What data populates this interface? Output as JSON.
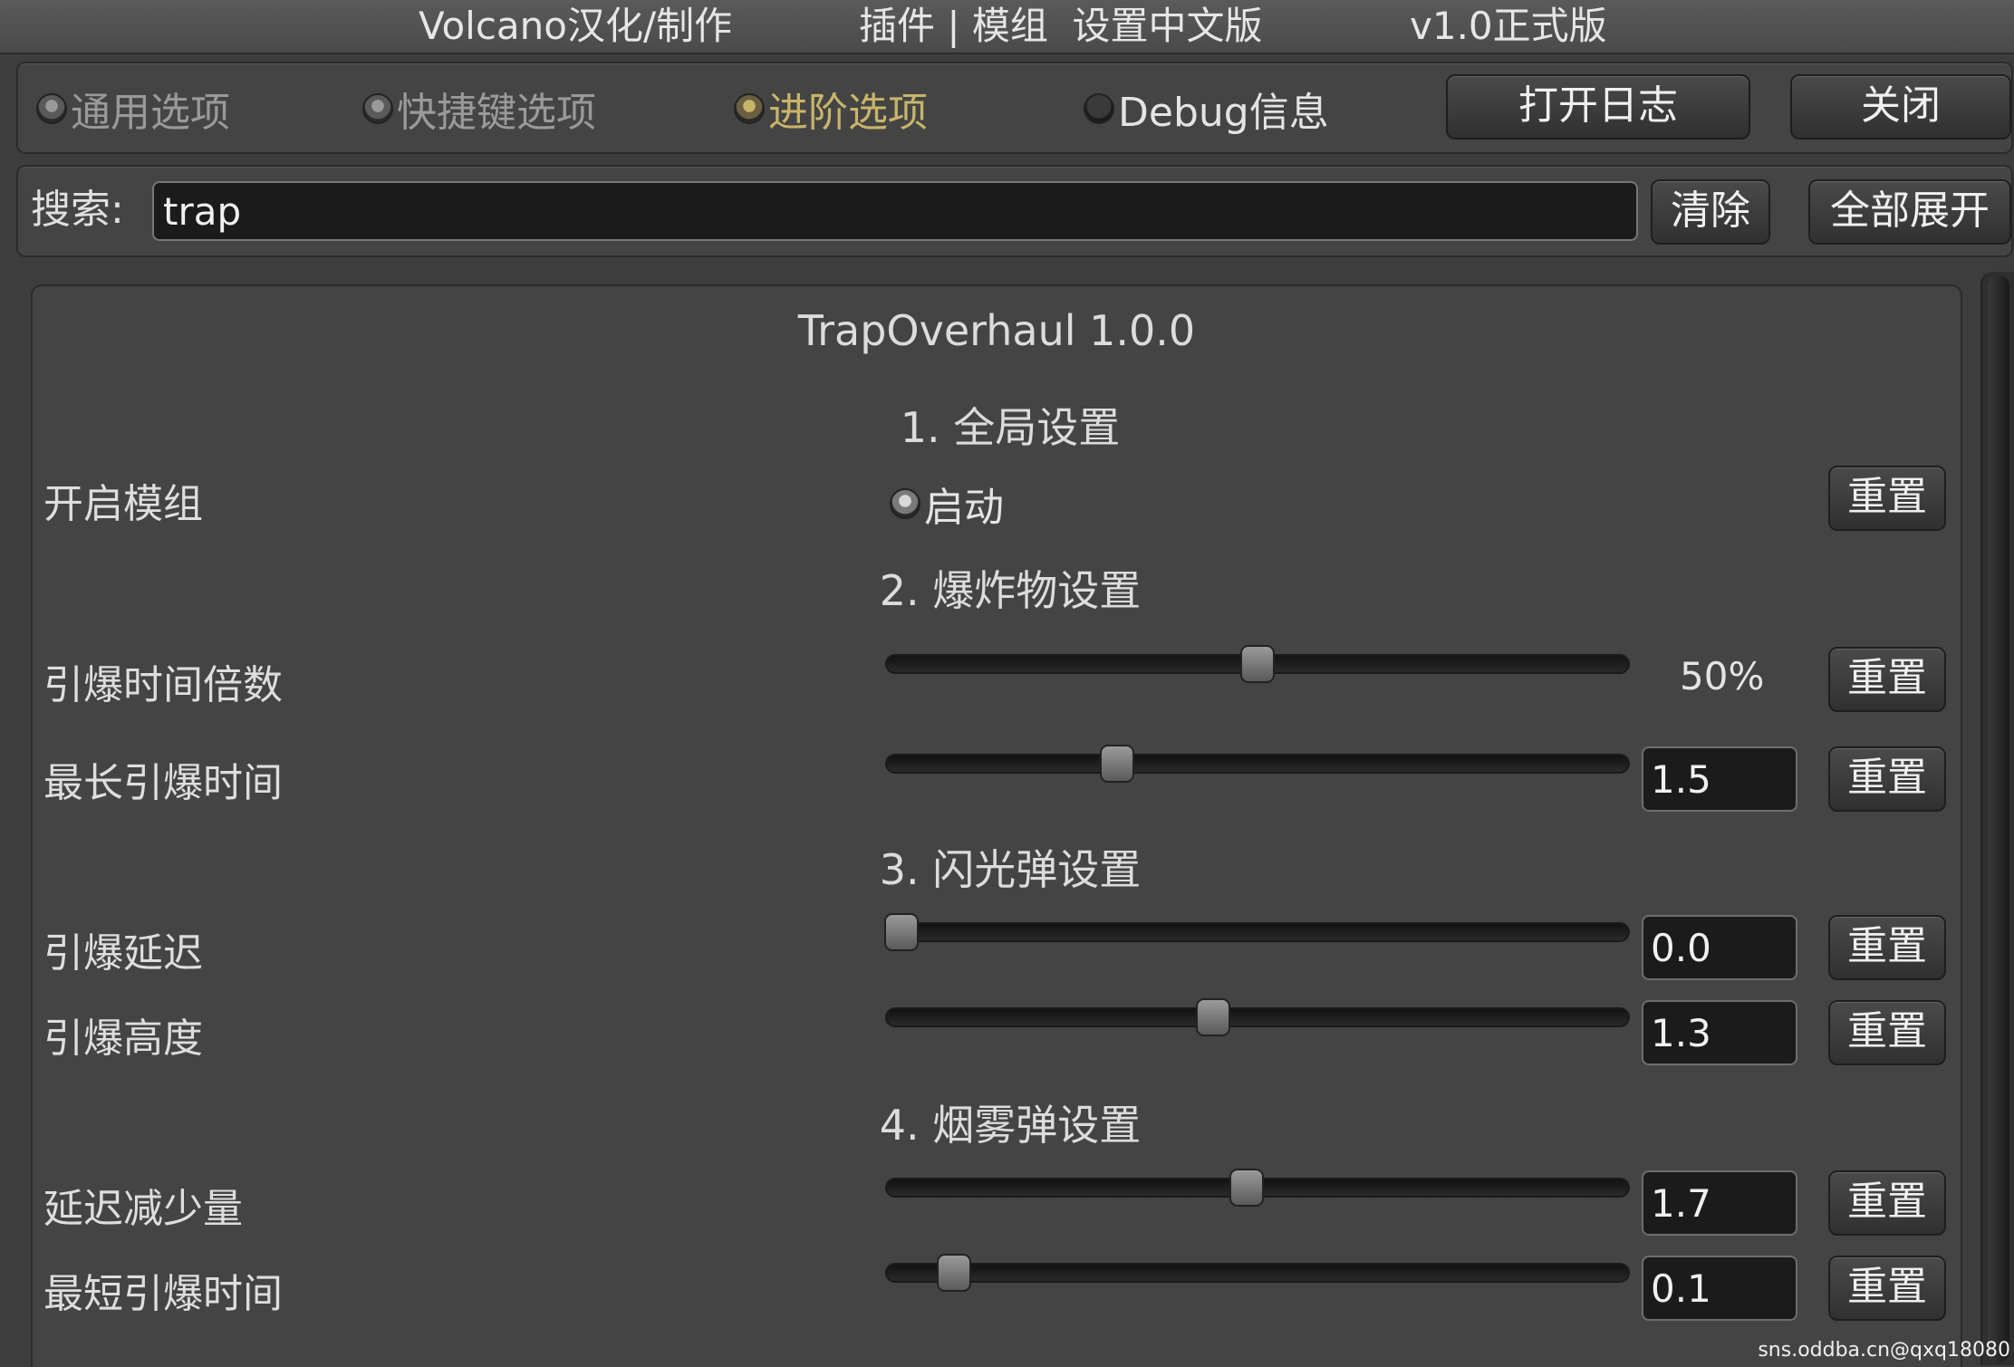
{
  "titlebar": {
    "part1": "Volcano汉化/制作",
    "part2": "插件 | 模组  设置中文版",
    "part3": "v1.0正式版"
  },
  "tabs": [
    {
      "label": "通用选项",
      "state": "inactive"
    },
    {
      "label": "快捷键选项",
      "state": "inactive"
    },
    {
      "label": "进阶选项",
      "state": "active"
    },
    {
      "label": "Debug信息",
      "state": "unchecked"
    }
  ],
  "toolbar": {
    "open_log_label": "打开日志",
    "close_label": "关闭"
  },
  "search": {
    "label": "搜索:",
    "value": "trap",
    "clear_label": "清除",
    "expand_all_label": "全部展开"
  },
  "mod": {
    "title": "TrapOverhaul 1.0.0",
    "sections": [
      {
        "heading": "1. 全局设置"
      },
      {
        "heading": "2. 爆炸物设置"
      },
      {
        "heading": "3. 闪光弹设置"
      },
      {
        "heading": "4. 烟雾弹设置"
      }
    ],
    "enable_mod": {
      "label": "开启模组",
      "toggle_label": "启动",
      "checked": true
    },
    "settings": [
      {
        "label": "引爆时间倍数",
        "slider_fraction": 0.5,
        "display": "50%",
        "kind": "text"
      },
      {
        "label": "最长引爆时间",
        "slider_fraction": 0.31,
        "value": "1.5",
        "kind": "input"
      },
      {
        "label": "引爆延迟",
        "slider_fraction": 0.02,
        "value": "0.0",
        "kind": "input"
      },
      {
        "label": "引爆高度",
        "slider_fraction": 0.44,
        "value": "1.3",
        "kind": "input"
      },
      {
        "label": "延迟减少量",
        "slider_fraction": 0.485,
        "value": "1.7",
        "kind": "input"
      },
      {
        "label": "最短引爆时间",
        "slider_fraction": 0.09,
        "value": "0.1",
        "kind": "input"
      }
    ],
    "reset_label": "重置"
  },
  "watermark": "sns.oddba.cn@qxq18080",
  "colors": {
    "background": "#3d3d3d",
    "active_tab": "#c8b46a",
    "input_bg": "#1b1b1b"
  }
}
